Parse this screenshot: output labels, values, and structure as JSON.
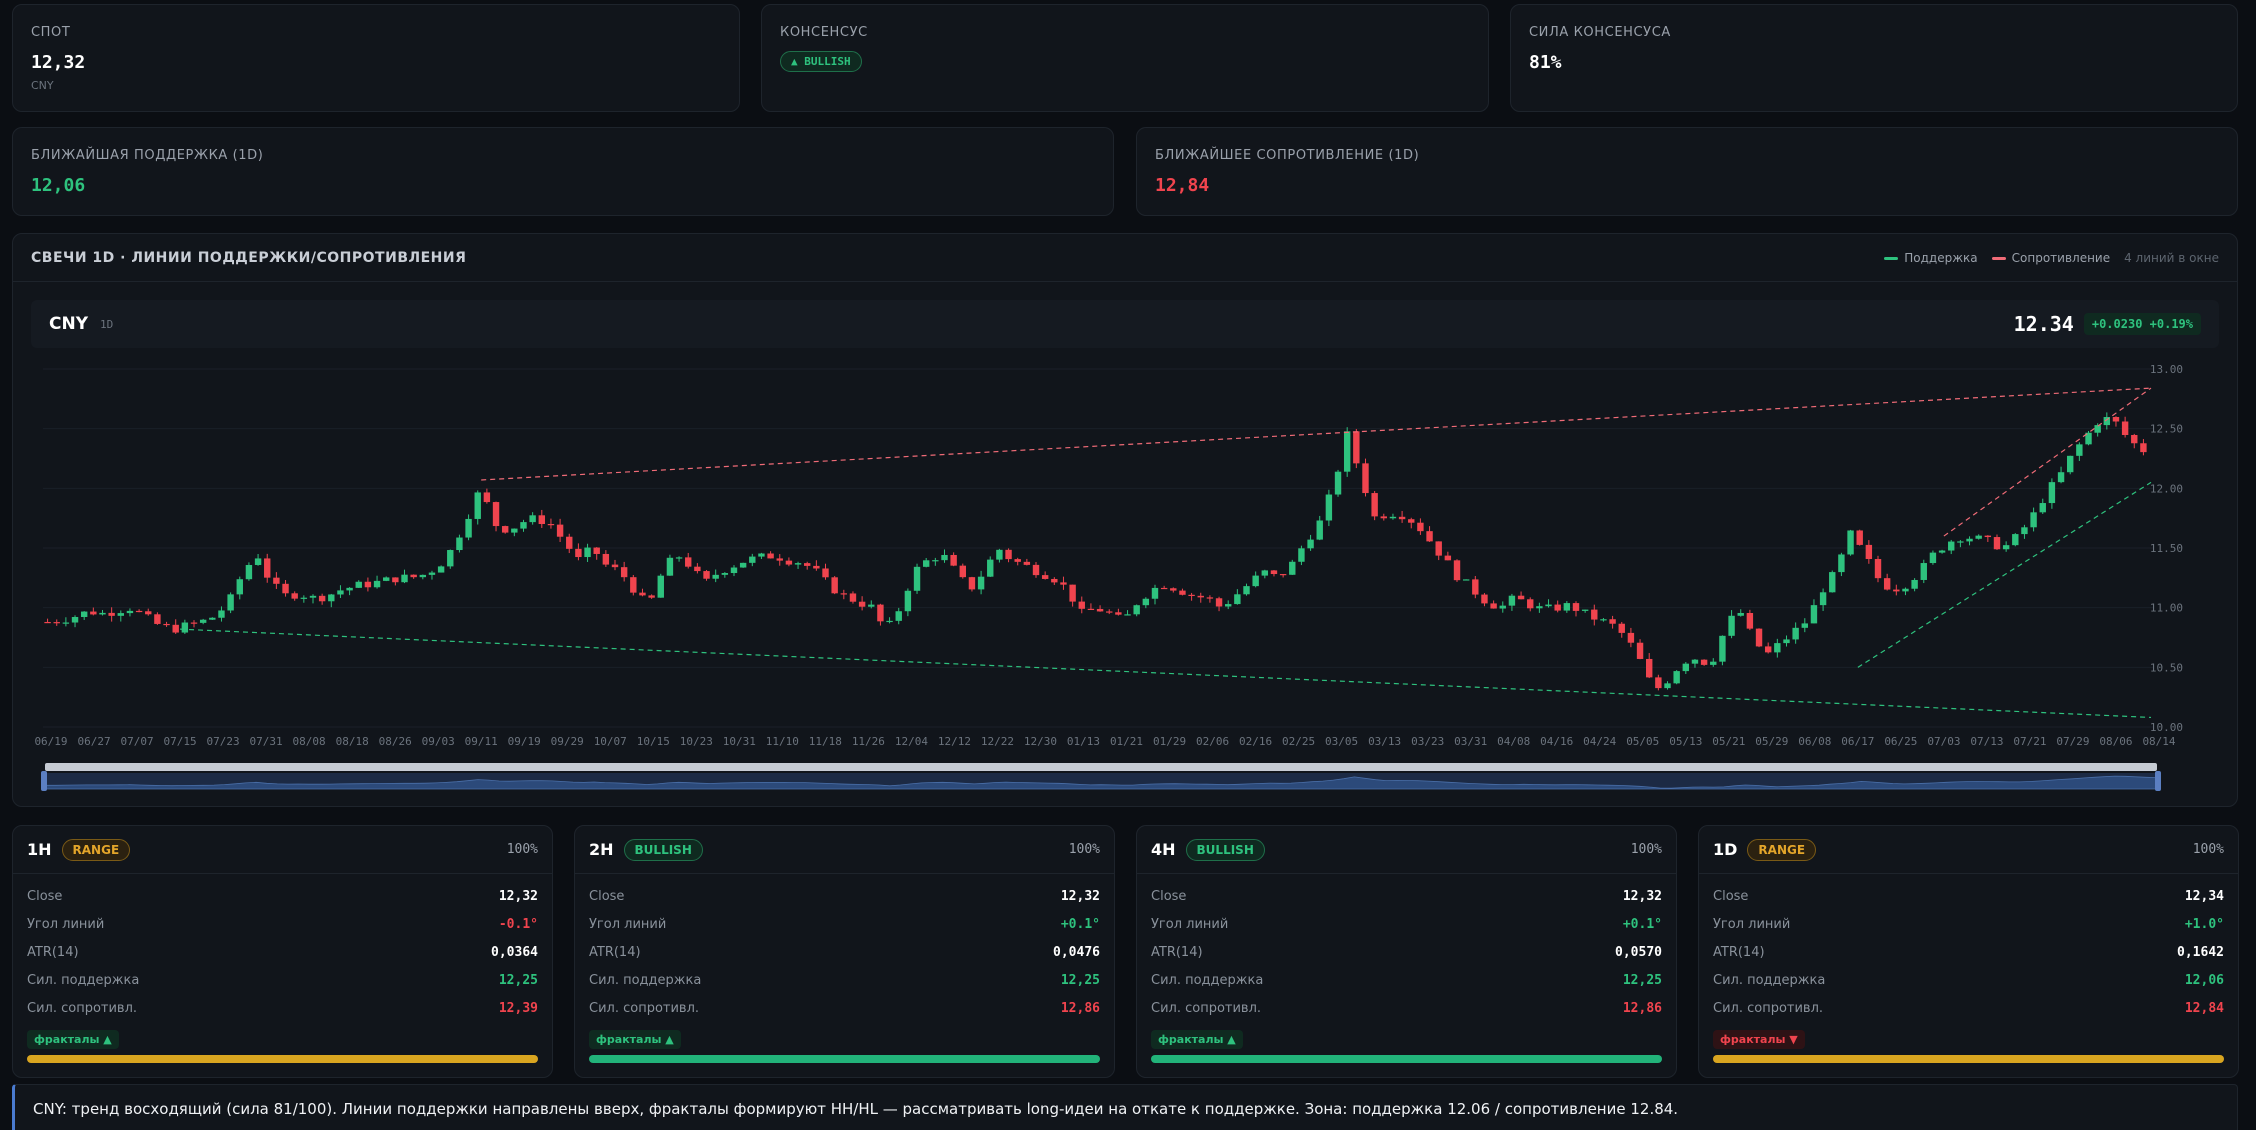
{
  "kpis": {
    "spot": {
      "label": "СПОТ",
      "value": "12,32",
      "unit": "CNY"
    },
    "consensus": {
      "label": "КОНСЕНСУС",
      "badge": "▲ BULLISH"
    },
    "strength": {
      "label": "СИЛА КОНСЕНСУСА",
      "value": "81%"
    },
    "support": {
      "label": "БЛИЖАЙШАЯ ПОДДЕРЖКА (1D)",
      "value": "12,06"
    },
    "resistance": {
      "label": "БЛИЖАЙШЕЕ СОПРОТИВЛЕНИЕ (1D)",
      "value": "12,84"
    }
  },
  "chart_panel": {
    "title": "СВЕЧИ 1D · ЛИНИИ ПОДДЕРЖКИ/СОПРОТИВЛЕНИЯ",
    "legend_support": "Поддержка",
    "legend_resistance": "Сопротивление",
    "lines_note": "4 линий в окне",
    "symbol": "CNY",
    "interval": "1D",
    "last_price": "12.34",
    "change": "+0.0230 +0.19%"
  },
  "chart_data": {
    "type": "candlestick",
    "yticks": [
      "13.00",
      "12.50",
      "12.00",
      "11.50",
      "11.00",
      "10.50",
      "10.00"
    ],
    "ylim": [
      10.0,
      13.0
    ],
    "xticks": [
      "06/19",
      "06/27",
      "07/07",
      "07/15",
      "07/23",
      "07/31",
      "08/08",
      "08/18",
      "08/26",
      "09/03",
      "09/11",
      "09/19",
      "09/29",
      "10/07",
      "10/15",
      "10/23",
      "10/31",
      "11/10",
      "11/18",
      "11/26",
      "12/04",
      "12/12",
      "12/22",
      "12/30",
      "01/13",
      "01/21",
      "01/29",
      "02/06",
      "02/16",
      "02/25",
      "03/05",
      "03/13",
      "03/23",
      "03/31",
      "04/08",
      "04/16",
      "04/24",
      "05/05",
      "05/13",
      "05/21",
      "05/29",
      "06/08",
      "06/17",
      "06/25",
      "07/03",
      "07/13",
      "07/21",
      "07/29",
      "08/06",
      "08/14"
    ],
    "close_path": [
      10.88,
      10.9,
      10.93,
      10.97,
      10.95,
      10.98,
      11.0,
      10.92,
      10.85,
      10.82,
      10.85,
      10.88,
      10.93,
      11.05,
      11.3,
      11.45,
      11.2,
      11.1,
      11.12,
      11.08,
      11.1,
      11.15,
      11.18,
      11.2,
      11.22,
      11.25,
      11.25,
      11.28,
      11.35,
      11.5,
      11.75,
      12.0,
      11.7,
      11.65,
      11.72,
      11.75,
      11.7,
      11.55,
      11.4,
      11.5,
      11.35,
      11.3,
      11.15,
      11.0,
      11.3,
      11.45,
      11.35,
      11.2,
      11.3,
      11.35,
      11.4,
      11.42,
      11.44,
      11.4,
      11.38,
      11.3,
      11.18,
      11.1,
      11.05,
      11.0,
      10.8,
      11.0,
      11.3,
      11.4,
      11.45,
      11.3,
      11.15,
      11.3,
      11.5,
      11.4,
      11.35,
      11.3,
      11.25,
      11.15,
      10.95,
      11.0,
      10.95,
      10.88,
      11.05,
      11.15,
      11.2,
      11.15,
      11.1,
      11.08,
      11.0,
      11.1,
      11.2,
      11.3,
      11.25,
      11.35,
      11.55,
      11.7,
      12.0,
      12.45,
      12.1,
      11.75,
      11.8,
      11.78,
      11.7,
      11.55,
      11.4,
      11.25,
      11.15,
      11.05,
      11.0,
      11.08,
      11.03,
      10.98,
      11.0,
      11.02,
      10.95,
      10.9,
      10.85,
      10.75,
      10.55,
      10.3,
      10.4,
      10.55,
      10.58,
      10.52,
      10.8,
      11.0,
      10.75,
      10.6,
      10.7,
      10.8,
      10.9,
      11.15,
      11.3,
      11.62,
      11.45,
      11.25,
      11.15,
      11.2,
      11.3,
      11.45,
      11.55,
      11.6,
      11.58,
      11.55,
      11.5,
      11.6,
      11.75,
      11.95,
      12.1,
      12.3,
      12.45,
      12.6,
      12.55,
      12.4,
      12.32
    ],
    "support_lines": [
      {
        "from": [
          "07/15",
          10.82
        ],
        "to": [
          "08/14",
          10.08
        ]
      },
      {
        "from": [
          "06/17",
          10.5
        ],
        "to": [
          "08/14",
          12.05
        ]
      }
    ],
    "resistance_lines": [
      {
        "from": [
          "09/11",
          12.07
        ],
        "to": [
          "08/14",
          12.84
        ]
      },
      {
        "from": [
          "07/03",
          11.6
        ],
        "to": [
          "08/14",
          12.84
        ]
      }
    ]
  },
  "timeframes": [
    {
      "name": "1H",
      "badge": "RANGE",
      "badge_type": "range",
      "pct": "100%",
      "close": "12,32",
      "angle": "-0.1°",
      "angle_sign": "neg",
      "atr": "0,0364",
      "sup": "12,25",
      "res": "12,39",
      "fractals": "фракталы ▲",
      "fractal_dir": "up",
      "bar_color": "#d9a520"
    },
    {
      "name": "2H",
      "badge": "BULLISH",
      "badge_type": "bull",
      "pct": "100%",
      "close": "12,32",
      "angle": "+0.1°",
      "angle_sign": "pos",
      "atr": "0,0476",
      "sup": "12,25",
      "res": "12,86",
      "fractals": "фракталы ▲",
      "fractal_dir": "up",
      "bar_color": "#22b37a"
    },
    {
      "name": "4H",
      "badge": "BULLISH",
      "badge_type": "bull",
      "pct": "100%",
      "close": "12,32",
      "angle": "+0.1°",
      "angle_sign": "pos",
      "atr": "0,0570",
      "sup": "12,25",
      "res": "12,86",
      "fractals": "фракталы ▲",
      "fractal_dir": "up",
      "bar_color": "#22b37a"
    },
    {
      "name": "1D",
      "badge": "RANGE",
      "badge_type": "range",
      "pct": "100%",
      "close": "12,34",
      "angle": "+1.0°",
      "angle_sign": "pos",
      "atr": "0,1642",
      "sup": "12,06",
      "res": "12,84",
      "fractals": "фракталы ▼",
      "fractal_dir": "down",
      "bar_color": "#d9a520"
    }
  ],
  "labels": {
    "close": "Close",
    "angle": "Угол линий",
    "atr": "ATR(14)",
    "sup": "Сил. поддержка",
    "res": "Сил. сопротивл."
  },
  "summary": "CNY: тренд восходящий (сила 81/100). Линии поддержки направлены вверх, фракталы формируют HH/HL — рассматривать long-идеи на откате к поддержке. Зона: поддержка 12.06 / сопротивление 12.84.",
  "colors": {
    "support": "#2ec27e",
    "resistance": "#f06b77",
    "up": "#2ec27e",
    "down": "#f0444e"
  }
}
